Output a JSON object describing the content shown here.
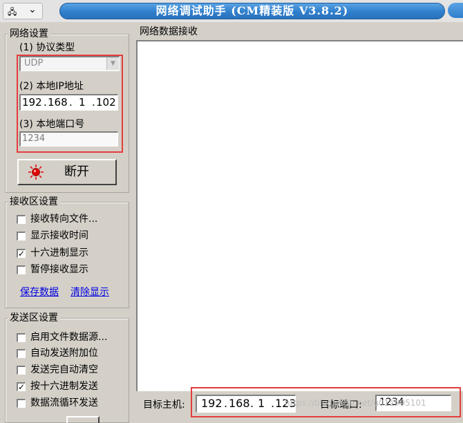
{
  "window": {
    "title": "网络调试助手 (CM精装版 V3.8.2)",
    "sysmenu_icon": "network-icon"
  },
  "network_settings": {
    "legend": "网络设置",
    "protocol_label": "(1) 协议类型",
    "protocol_value": "UDP",
    "local_ip_label": "(2) 本地IP地址",
    "ip_octets": [
      "192",
      "168",
      "1",
      "102"
    ],
    "local_port_label": "(3) 本地端口号",
    "local_port_value": "1234",
    "disconnect_label": "断开",
    "status_led_color": "#e00000"
  },
  "receive_settings": {
    "legend": "接收区设置",
    "options": [
      {
        "label": "接收转向文件...",
        "checked": false
      },
      {
        "label": "显示接收时间",
        "checked": false
      },
      {
        "label": "十六进制显示",
        "checked": true
      },
      {
        "label": "暂停接收显示",
        "checked": false
      }
    ],
    "save_link": "保存数据",
    "clear_link": "清除显示"
  },
  "send_settings": {
    "legend": "发送区设置",
    "options": [
      {
        "label": "启用文件数据源...",
        "checked": false
      },
      {
        "label": "自动发送附加位",
        "checked": false
      },
      {
        "label": "发送完自动清空",
        "checked": false
      },
      {
        "label": "按十六进制发送",
        "checked": true
      },
      {
        "label": "数据流循环发送",
        "checked": false
      }
    ]
  },
  "receive_panel": {
    "legend": "网络数据接收"
  },
  "target": {
    "host_label": "目标主机:",
    "host_octets": [
      "192",
      "168",
      "1",
      "123"
    ],
    "port_label": "目标端口:",
    "port_value": "1234"
  },
  "watermark": "https://blog.csdn.net/u011995101",
  "colors": {
    "highlight_box": "#e53b3b",
    "title_bar": "#2f7fcc",
    "link": "#0000e0"
  }
}
